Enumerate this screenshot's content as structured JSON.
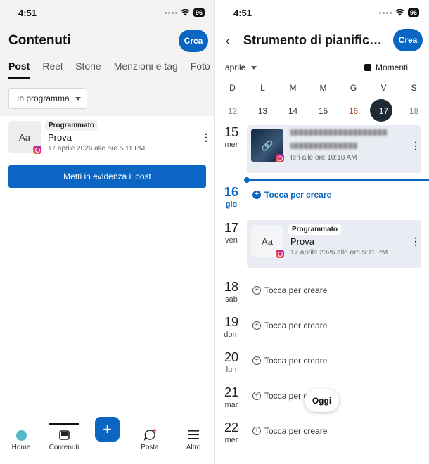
{
  "left": {
    "status": {
      "time": "4:51",
      "battery": "96"
    },
    "title": "Contenuti",
    "create_label": "Crea",
    "tabs": [
      {
        "label": "Post",
        "active": true
      },
      {
        "label": "Reel"
      },
      {
        "label": "Storie"
      },
      {
        "label": "Menzioni e tag"
      },
      {
        "label": "Foto"
      }
    ],
    "filter": {
      "label": "In programma"
    },
    "post": {
      "thumb_text": "Aa",
      "badge": "Programmato",
      "title": "Prova",
      "date": "17 aprile 2026 alle ore 5:11 PM"
    },
    "boost_label": "Metti in evidenza il post",
    "nav": [
      {
        "label": "Home",
        "icon": "home-dot-icon"
      },
      {
        "label": "Contenuti",
        "icon": "content-icon"
      },
      {
        "label": "Posta",
        "icon": "chat-icon"
      },
      {
        "label": "Altro",
        "icon": "menu-icon"
      }
    ],
    "fab_icon": "plus-icon"
  },
  "right": {
    "status": {
      "time": "4:51",
      "battery": "96"
    },
    "title": "Strumento di pianific…",
    "create_label": "Crea",
    "month": "aprile",
    "moments": "Momenti",
    "week_letters": [
      "D",
      "L",
      "M",
      "M",
      "G",
      "V",
      "S"
    ],
    "week_numbers": [
      "12",
      "13",
      "14",
      "15",
      "16",
      "17",
      "18"
    ],
    "days": [
      {
        "num": "15",
        "name": "mer"
      },
      {
        "num": "16",
        "name": "gio"
      },
      {
        "num": "17",
        "name": "ven"
      },
      {
        "num": "18",
        "name": "sab"
      },
      {
        "num": "19",
        "name": "dom"
      },
      {
        "num": "20",
        "name": "lun"
      },
      {
        "num": "21",
        "name": "mar"
      },
      {
        "num": "22",
        "name": "mer"
      }
    ],
    "link_post": {
      "date": "Ieri alle ore 10:18 AM"
    },
    "scheduled_post": {
      "thumb_text": "Aa",
      "badge": "Programmato",
      "title": "Prova",
      "date": "17 aprile 2026 alle ore 5:11 PM"
    },
    "create_label_row": "Tocca per creare",
    "today_button": "Oggi"
  },
  "colors": {
    "accent": "#0a66c2",
    "today_circle": "#1f2a36"
  }
}
